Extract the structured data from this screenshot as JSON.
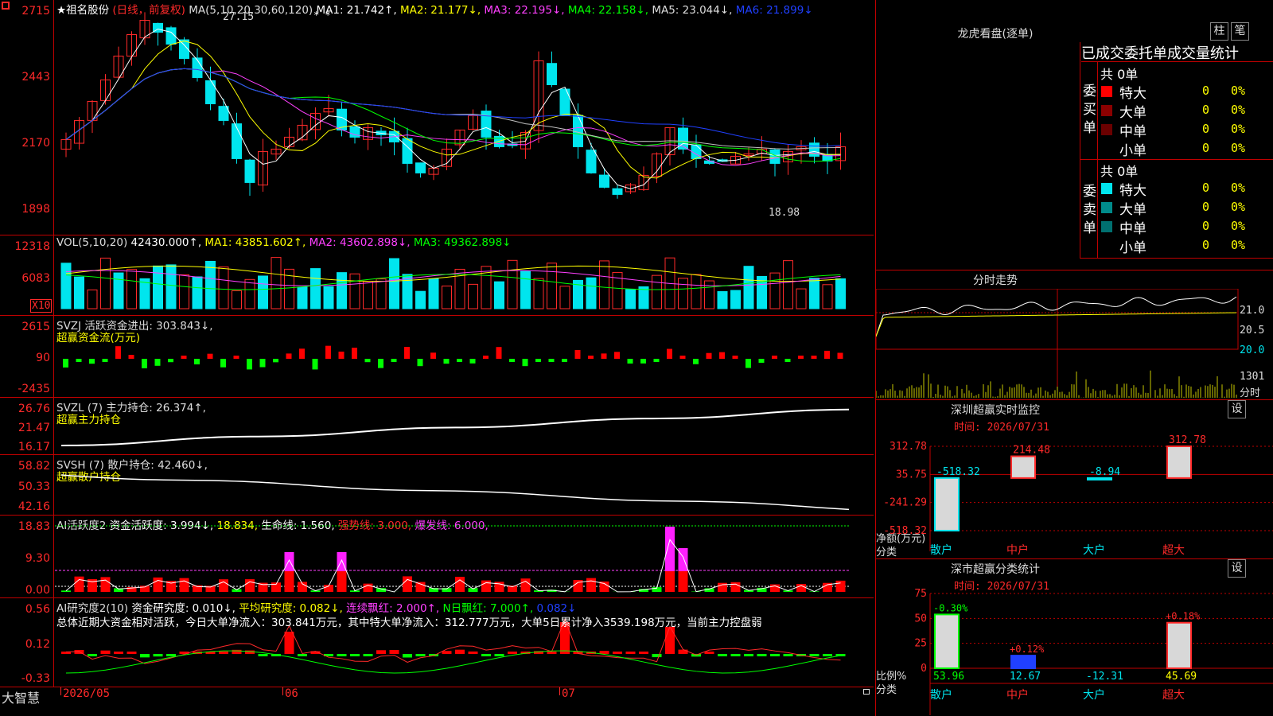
{
  "colors": {
    "up": "#ff2a2a",
    "down": "#00e5ee",
    "grid": "#c00000",
    "ma1": "#ffffff",
    "ma2": "#ffff00",
    "ma3": "#ff40ff",
    "ma4": "#00ff00",
    "ma5": "#c0c0c0",
    "ma6": "#2040ff"
  },
  "kline": {
    "stock_name": "★祖名股份",
    "period": "(日线，前复权)",
    "ma_params": "MA(5,10,20,30,60,120)",
    "ma1": "MA1: 21.742↑,",
    "ma2": "MA2: 21.177↓,",
    "ma3": "MA3: 22.195↓,",
    "ma4": "MA4: 22.158↓,",
    "ma5": "MA5: 23.044↓,",
    "ma6": "MA6: 21.899↓",
    "y_labels": [
      "2715",
      "2443",
      "2170",
      "1898"
    ],
    "high_label": "27.15",
    "low_label": "18.98",
    "star_marks": "* *"
  },
  "vol": {
    "params": "VOL(5,10,20)",
    "value": "42430.000↑,",
    "ma1": "MA1: 43851.602↑,",
    "ma2": "MA2: 43602.898↓,",
    "ma3": "MA3: 49362.898↓",
    "y_labels": [
      "12318",
      "6083"
    ],
    "unit": "X10"
  },
  "svzj": {
    "title": "SVZJ  活跃资金进出: 303.843↓,",
    "subtitle": "超赢资金流(万元)",
    "y_labels": [
      "2615",
      "90",
      "-2435"
    ]
  },
  "svzl": {
    "title": "SVZL (7) 主力持仓: 26.374↑,",
    "subtitle": "超赢主力持仓",
    "y_labels": [
      "26.76",
      "21.47",
      "16.17"
    ]
  },
  "svsh": {
    "title": "SVSH (7) 散户持仓: 42.460↓,",
    "subtitle": "超赢散户持仓",
    "y_labels": [
      "58.82",
      "50.33",
      "42.16"
    ]
  },
  "ai_active": {
    "name": "AI活跃度2",
    "activity": "资金活跃度: 3.994↓,",
    "v2": "18.834,",
    "life": "生命线: 1.560,",
    "strong": "强势线: 3.000,",
    "burst": "爆发线: 6.000,",
    "y_labels": [
      "18.83",
      "9.30",
      "0.00"
    ]
  },
  "ai_research": {
    "name": "AI研究度2(10)",
    "research": "资金研究度: 0.010↓,",
    "avg": "平均研究度: 0.082↓,",
    "cont": "连续飘红: 2.000↑,",
    "nday": "N日飘红: 7.000↑,",
    "last": "0.082↓",
    "summary": "总体近期大资金相对活跃，今日大单净流入：303.841万元，其中特大单净流入：312.777万元，大单5日累计净入3539.198万元，当前主力控盘弱",
    "y_labels": [
      "0.56",
      "0.12",
      "-0.33"
    ]
  },
  "footer": {
    "brand": "大智慧",
    "dates": [
      "2026/05",
      "06",
      "07"
    ]
  },
  "lhb": {
    "title": "龙虎看盘(逐单)",
    "btn1": "柱",
    "btn2": "笔",
    "header": "已成交委托单成交量统计",
    "buy_label": "委买单",
    "sell_label": "委卖单",
    "buy_total": "共 0单",
    "sell_total": "共 0单",
    "rows": [
      {
        "name": "特大",
        "count": "0",
        "pct": "0%"
      },
      {
        "name": "大单",
        "count": "0",
        "pct": "0%"
      },
      {
        "name": "中单",
        "count": "0",
        "pct": "0%"
      },
      {
        "name": "小单",
        "count": "0",
        "pct": "0%"
      }
    ]
  },
  "intraday": {
    "title": "分时走势",
    "labels": [
      "21.0",
      "20.5",
      "20.0"
    ],
    "vol_label": "1301",
    "vol_unit": "分时"
  },
  "sz_monitor": {
    "title": "深圳超赢实时监控",
    "set_btn": "设",
    "time": "时间: 2026/07/31",
    "y_labels": [
      "312.78",
      "35.75",
      "-241.29",
      "-518.32"
    ],
    "axis_title": "净额(万元)",
    "cat_title": "分类",
    "chart_data": {
      "type": "bar",
      "categories": [
        "散户",
        "中户",
        "大户",
        "超大"
      ],
      "values": [
        -518.32,
        214.48,
        -8.94,
        312.78
      ],
      "value_labels": [
        "-518.32",
        "214.48",
        "-8.94",
        "312.78"
      ],
      "ylim": [
        -518.32,
        312.78
      ]
    }
  },
  "sz_class": {
    "title": "深市超赢分类统计",
    "set_btn": "设",
    "time": "时间: 2026/07/31",
    "y_labels": [
      "75",
      "50",
      "25",
      "0"
    ],
    "axis_title": "比例%",
    "cat_title": "分类",
    "chart_data": {
      "type": "bar",
      "categories": [
        "散户",
        "中户",
        "大户",
        "超大"
      ],
      "values": [
        53.96,
        12.67,
        -12.31,
        45.69
      ],
      "value_labels": [
        "53.96",
        "12.67",
        "-12.31",
        "45.69"
      ],
      "changes": [
        "-0.30%",
        "+0.12%",
        "",
        "+0.18%"
      ],
      "ylim": [
        0,
        75
      ]
    }
  }
}
